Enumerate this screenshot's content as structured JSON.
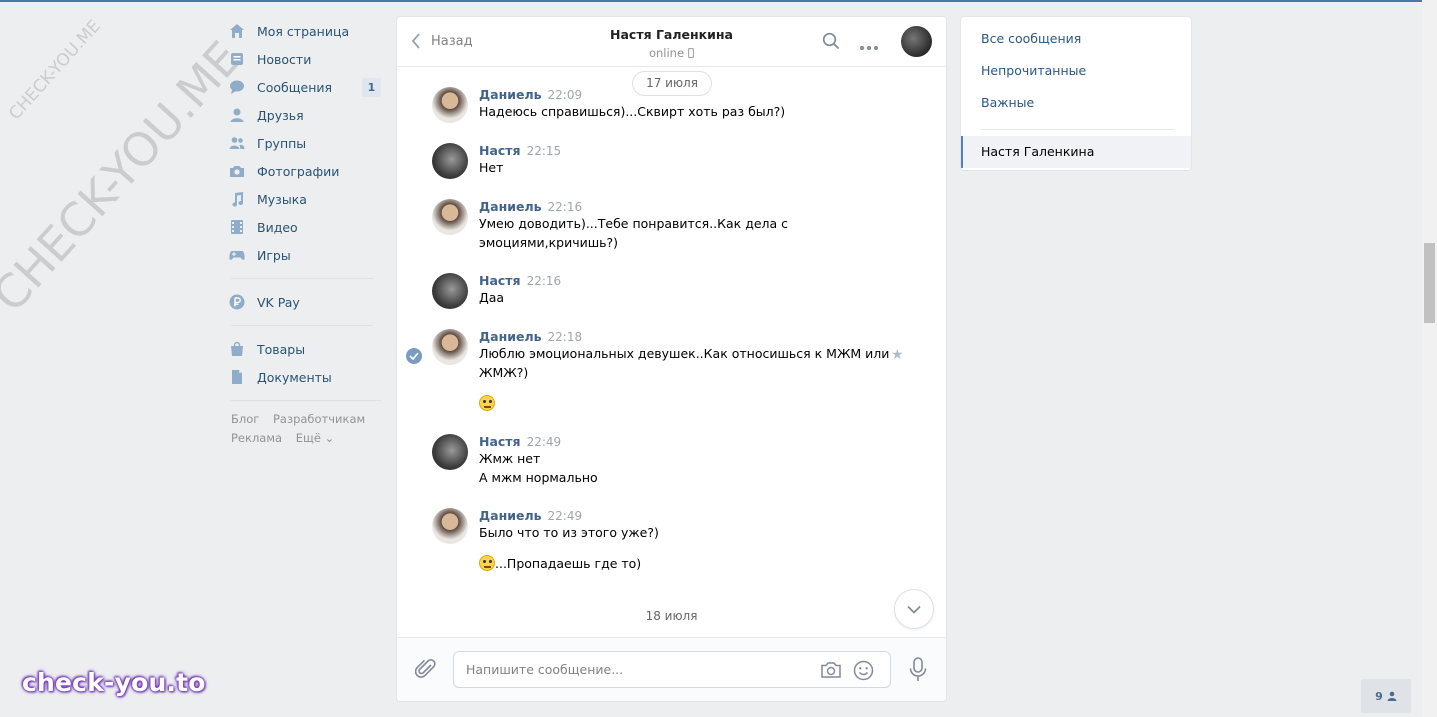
{
  "watermark": {
    "small": "CHECK-YOU.ME",
    "large": "CHECK-YOU.ME",
    "brand": "check-you.to"
  },
  "sidebar": {
    "items": [
      {
        "label": "Моя страница",
        "icon": "home-icon"
      },
      {
        "label": "Новости",
        "icon": "news-icon"
      },
      {
        "label": "Сообщения",
        "icon": "chat-bubble-icon",
        "badge": "1"
      },
      {
        "label": "Друзья",
        "icon": "user-icon"
      },
      {
        "label": "Группы",
        "icon": "users-icon"
      },
      {
        "label": "Фотографии",
        "icon": "camera-icon"
      },
      {
        "label": "Музыка",
        "icon": "music-note-icon"
      },
      {
        "label": "Видео",
        "icon": "film-icon"
      },
      {
        "label": "Игры",
        "icon": "gamepad-icon"
      },
      {
        "label": "VK Pay",
        "icon": "ruble-coin-icon"
      },
      {
        "label": "Товары",
        "icon": "shopping-bag-icon"
      },
      {
        "label": "Документы",
        "icon": "document-icon"
      }
    ],
    "footer": {
      "blog": "Блог",
      "developers": "Разработчикам",
      "ads": "Реклама",
      "more": "Ещё ⌄"
    }
  },
  "chat": {
    "back_label": "Назад",
    "peer_name": "Настя Галенкина",
    "peer_status": "online",
    "date_top": "17 июля",
    "date_bottom": "18 июля",
    "messages": [
      {
        "author": "Даниель",
        "time": "22:09",
        "lines": [
          "Надеюсь справишься)...Сквирт хоть раз был?)"
        ]
      },
      {
        "author": "Настя",
        "time": "22:15",
        "lines": [
          "Нет"
        ]
      },
      {
        "author": "Даниель",
        "time": "22:16",
        "lines": [
          "Умею доводить)...Тебе понравится..Как дела с",
          "эмоциями,кричишь?)"
        ]
      },
      {
        "author": "Настя",
        "time": "22:16",
        "lines": [
          "Даа"
        ]
      },
      {
        "author": "Даниель",
        "time": "22:18",
        "lines": [
          "Люблю эмоциональных девушек..Как относишься к МЖМ или",
          "ЖМЖ?)"
        ]
      },
      {
        "author": "Настя",
        "time": "22:49",
        "lines": [
          "Жмж нет",
          "А мжм нормально"
        ]
      },
      {
        "author": "Даниель",
        "time": "22:49",
        "lines": [
          "Было что то из этого уже?)",
          "...Пропадаешь где то)"
        ]
      }
    ],
    "composer_placeholder": "Напишите сообщение..."
  },
  "filters": {
    "all": "Все сообщения",
    "unread": "Непрочитанные",
    "important": "Важные",
    "active_chat": "Настя Галенкина"
  },
  "online_count": "9",
  "colors": {
    "accent": "#4a76a8",
    "link": "#2a5885",
    "author": "#42648b",
    "background": "#edeef0"
  }
}
